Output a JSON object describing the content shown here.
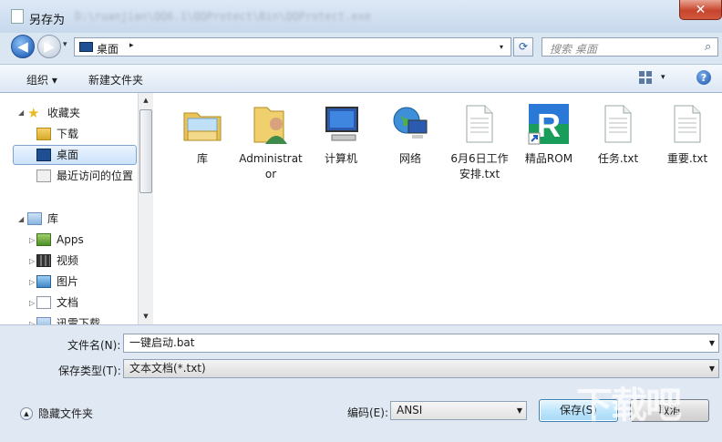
{
  "window": {
    "title": "另存为",
    "title_path": "D:\\ruanjian\\QQ6.1\\QQProtect\\Bin\\QQProtect.exe",
    "close_label": "✕"
  },
  "nav": {
    "back": "◀",
    "forward": "▶",
    "history": "▾",
    "address": "桌面",
    "address_caret": "▸",
    "address_dropdown": "▾",
    "refresh": "⟳",
    "search_placeholder": "搜索 桌面",
    "search_icon": "⌕"
  },
  "toolbar": {
    "organize": "组织 ▾",
    "new_folder": "新建文件夹",
    "view_caret": "▾",
    "help": "?"
  },
  "navpane": {
    "favorites": "收藏夹",
    "favorites_items": [
      "下载",
      "桌面",
      "最近访问的位置"
    ],
    "libraries": "库",
    "library_items": [
      "Apps",
      "视频",
      "图片",
      "文档",
      "迅雷下载"
    ]
  },
  "files": [
    {
      "name": "库",
      "icon": "library-folder-icon"
    },
    {
      "name": "Administrator",
      "icon": "user-folder-icon"
    },
    {
      "name": "计算机",
      "icon": "computer-icon"
    },
    {
      "name": "网络",
      "icon": "network-icon"
    },
    {
      "name": "6月6日工作安排.txt",
      "icon": "text-file-icon"
    },
    {
      "name": "精品ROM",
      "icon": "rom-shortcut-icon"
    },
    {
      "name": "任务.txt",
      "icon": "text-file-icon"
    },
    {
      "name": "重要.txt",
      "icon": "text-file-icon"
    }
  ],
  "form": {
    "filename_label": "文件名(N):",
    "filename_value": "一键启动.bat",
    "filetype_label": "保存类型(T):",
    "filetype_value": "文本文档(*.txt)",
    "encoding_label": "编码(E):",
    "encoding_value": "ANSI",
    "save": "保存(S)",
    "cancel": "取消",
    "hide_folders": "隐藏文件夹"
  },
  "watermark": "下载吧",
  "colors": {
    "selection": "#cce3fb",
    "accent": "#1f4f93"
  }
}
